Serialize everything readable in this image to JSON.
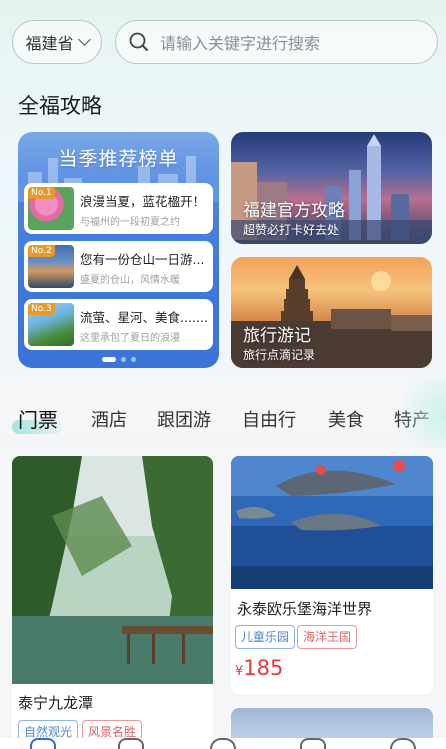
{
  "header": {
    "province": "福建省",
    "search_placeholder": "请输入关键字进行搜索"
  },
  "section_title": "全福攻略",
  "season_list": {
    "title": "当季推荐榜单",
    "items": [
      {
        "rank": "No.1",
        "title": "浪漫当夏，蓝花楹开！",
        "subtitle": "与福州的一段初夏之约"
      },
      {
        "rank": "No.2",
        "title": "您有一份仓山一日游...",
        "subtitle": "盛夏的仓山，风情水暖"
      },
      {
        "rank": "No.3",
        "title": "流萤、星河、美食........",
        "subtitle": "这里承包了夏日的浪漫"
      }
    ]
  },
  "promos": [
    {
      "title": "福建官方攻略",
      "subtitle": "超赞必打卡好去处"
    },
    {
      "title": "旅行游记",
      "subtitle": "旅行点滴记录"
    }
  ],
  "tabs": [
    "门票",
    "酒店",
    "跟团游",
    "自由行",
    "美食",
    "特产"
  ],
  "products": [
    {
      "name": "泰宁九龙潭",
      "tags": [
        "自然观光",
        "风景名胜"
      ]
    },
    {
      "name": "永泰欧乐堡海洋世界",
      "tags": [
        "儿童乐园",
        "海洋王国"
      ],
      "price_symbol": "¥",
      "price": "185"
    }
  ],
  "colors": {
    "accent_teal": "#a8e3dd",
    "price_red": "#e53b3b",
    "season_blue": "#3f79dc"
  }
}
